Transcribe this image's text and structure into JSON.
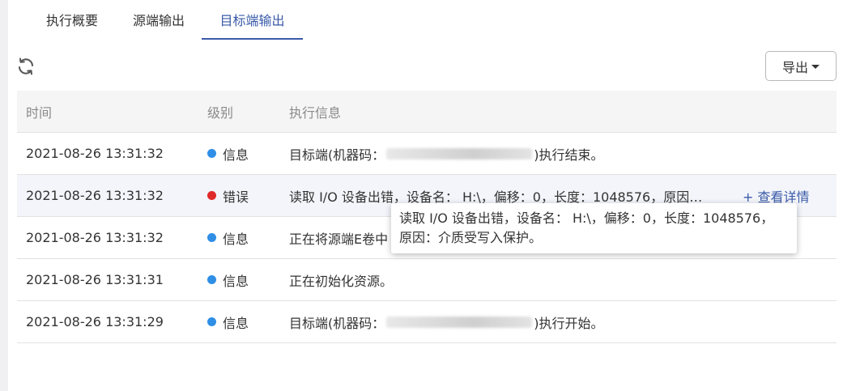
{
  "tabs": [
    {
      "label": "执行概要",
      "active": false
    },
    {
      "label": "源端输出",
      "active": false
    },
    {
      "label": "目标端输出",
      "active": true
    }
  ],
  "toolbar": {
    "refresh_icon": "refresh-icon",
    "export_label": "导出"
  },
  "table": {
    "columns": [
      "时间",
      "级别",
      "执行信息"
    ],
    "rows": [
      {
        "time": "2021-08-26 13:31:32",
        "level": "信息",
        "level_color": "#2f8fe6",
        "message_prefix": "目标端(机器码：",
        "message_suffix": ")执行结束。"
      },
      {
        "time": "2021-08-26 13:31:32",
        "level": "错误",
        "level_color": "#e02a2a",
        "message": "读取 I/O 设备出错，设备名： H:\\，偏移：0，长度：1048576，原因…",
        "detail_link": "+ 查看详情"
      },
      {
        "time": "2021-08-26 13:31:32",
        "level": "信息",
        "level_color": "#2f8fe6",
        "message": "正在将源端E卷中"
      },
      {
        "time": "2021-08-26 13:31:31",
        "level": "信息",
        "level_color": "#2f8fe6",
        "message": "正在初始化资源。"
      },
      {
        "time": "2021-08-26 13:31:29",
        "level": "信息",
        "level_color": "#2f8fe6",
        "message_prefix": "目标端(机器码：",
        "message_suffix": ")执行开始。"
      }
    ]
  },
  "tooltip": {
    "line1": "读取 I/O 设备出错，设备名： H:\\，偏移：0，长度：1048576，",
    "line2": "原因：介质受写入保护。"
  },
  "colors": {
    "accent": "#3a5aa8",
    "info_dot": "#2f8fe6",
    "error_dot": "#e02a2a"
  }
}
